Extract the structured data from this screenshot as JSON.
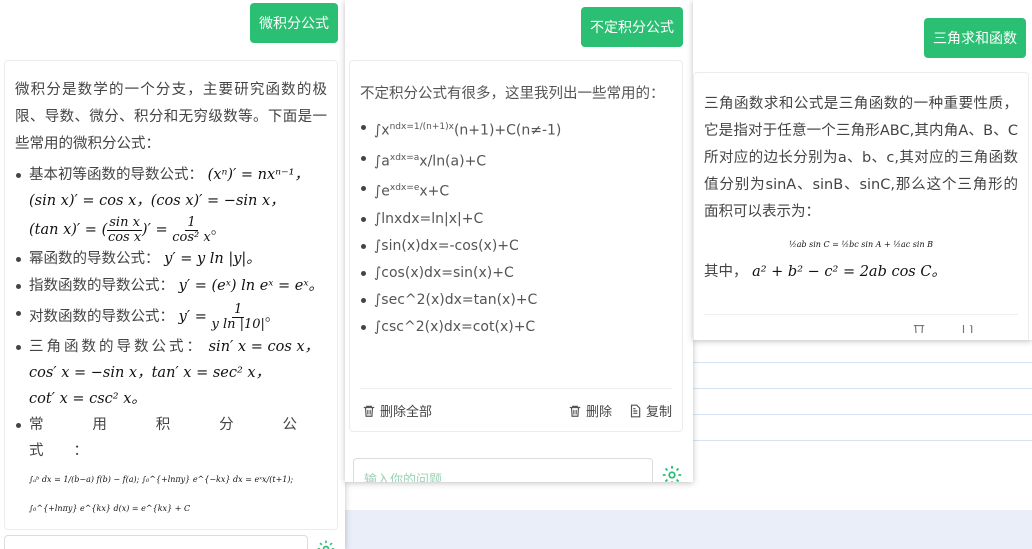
{
  "panels": {
    "calculus": {
      "button": "微积分公式",
      "intro": "微积分是数学的一个分支，主要研究函数的极限、导数、微分、积分和无穷级数等。下面是一些常用的微积分公式：",
      "items": [
        {
          "label": "基本初等函数的导数公式：",
          "formula": "(xⁿ)′ = nxⁿ⁻¹，"
        },
        {
          "label": "",
          "formula": "(sin x)′ = cos x，(cos x)′ = −sin x，"
        },
        {
          "label": "",
          "formula_a": "(tan x)′ = (",
          "num": "sin x",
          "den": "cos x",
          "formula_b": ")′ = ",
          "num2": "1",
          "den2": "cos² x",
          "tail": "。"
        },
        {
          "label": "幂函数的导数公式：",
          "formula": "y′ = y ln |y|。"
        },
        {
          "label": "指数函数的导数公式：",
          "formula": "y′ = (eˣ) ln eˣ = eˣ。"
        },
        {
          "label": "对数函数的导数公式：",
          "formula_a": "y′ = ",
          "num": "1",
          "den": "y ln |10|",
          "tail": "。"
        },
        {
          "label": "三角函数的导数公式：",
          "formula": "sin′ x = cos x，"
        },
        {
          "label": "",
          "formula": "cos′ x = −sin x，tan′ x = sec² x，"
        },
        {
          "label": "",
          "formula": "cot′ x = csc² x。"
        },
        {
          "label": "常用积分公式：",
          "formula": ""
        }
      ],
      "integral_line": "∫ₐᵇ dx = 1/(b−a) f(b) − f(a); ∫₀^{+lnπy} e^{−kx} dx = eˣx/(t+1); ∫₀^{+lnπy} e^{kx} d(x) = e^{kx} + C"
    },
    "indefinite": {
      "button": "不定积分公式",
      "intro": "不定积分公式有很多，这里我列出一些常用的：",
      "formulas": [
        {
          "base": "∫x",
          "sup": "ndx=1/(n+1)x",
          "tail": "(n+1)+C(n≠-1)"
        },
        {
          "base": "∫a",
          "sup": "xdx=a",
          "tail": "x/ln(a)+C"
        },
        {
          "base": "∫e",
          "sup": "xdx=e",
          "tail": "x+C"
        },
        {
          "base": "∫lnxdx=ln|x|+C",
          "sup": "",
          "tail": ""
        },
        {
          "base": "∫sin(x)dx=-cos(x)+C",
          "sup": "",
          "tail": ""
        },
        {
          "base": "∫cos(x)dx=sin(x)+C",
          "sup": "",
          "tail": ""
        },
        {
          "base": "∫sec^2(x)dx=tan(x)+C",
          "sup": "",
          "tail": ""
        },
        {
          "base": "∫csc^2(x)dx=cot(x)+C",
          "sup": "",
          "tail": ""
        }
      ],
      "delete_all": "删除全部",
      "delete": "删除",
      "copy": "复制",
      "input_placeholder": "输入你的问题"
    },
    "trig": {
      "button": "三角求和函数",
      "intro": "三角函数求和公式是三角函数的一种重要性质，它是指对于任意一个三角形ABC,其内角A、B、C所对应的边长分别为a、b、c,其对应的三角函数值分别为sinA、sinB、sinC,那么这个三角形的面积可以表示为：",
      "area_formula": "½ab sin C = ½bc sin A + ½ac sin B",
      "where_label": "其中，",
      "where_formula": "a² + b² − c² = 2ab cos C。"
    }
  },
  "colors": {
    "accent": "#2bbf73",
    "text": "#444444",
    "border": "#ececec"
  },
  "icons": [
    "trash-icon",
    "copy-icon",
    "gear-icon"
  ]
}
